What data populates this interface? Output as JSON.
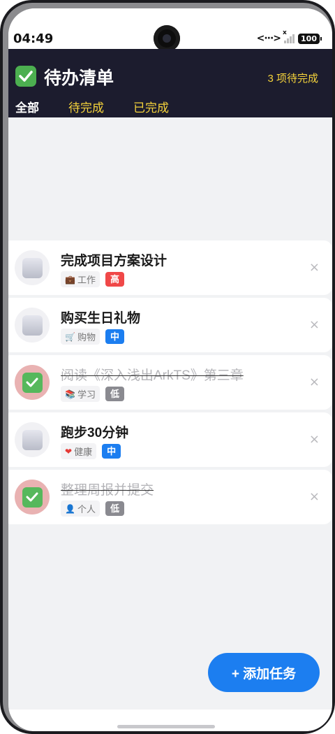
{
  "status_bar": {
    "time": "04:49",
    "network_symbol": "<···>",
    "signal_x": "x",
    "battery": "100"
  },
  "header": {
    "title": "待办清单",
    "pending_text": "3 项待完成",
    "tabs": [
      {
        "label": "全部",
        "active": true
      },
      {
        "label": "待完成",
        "active": false
      },
      {
        "label": "已完成",
        "active": false
      }
    ]
  },
  "tasks": [
    {
      "title": "完成项目方案设计",
      "category_icon": "briefcase-icon",
      "category_emoji": "💼",
      "category": "工作",
      "priority": "高",
      "priority_color": "#f04848",
      "done": false
    },
    {
      "title": "购买生日礼物",
      "category_icon": "cart-icon",
      "category_emoji": "🛒",
      "category": "购物",
      "priority": "中",
      "priority_color": "#1c7ef0",
      "done": false
    },
    {
      "title": "阅读《深入浅出ArkTS》第三章",
      "category_icon": "books-icon",
      "category_emoji": "📚",
      "category": "学习",
      "priority": "低",
      "priority_color": "#8a8a90",
      "done": true
    },
    {
      "title": "跑步30分钟",
      "category_icon": "heart-icon",
      "category_emoji": "❤",
      "category": "健康",
      "priority": "中",
      "priority_color": "#1c7ef0",
      "done": false
    },
    {
      "title": "整理周报并提交",
      "category_icon": "person-icon",
      "category_emoji": "👤",
      "category": "个人",
      "priority": "低",
      "priority_color": "#8a8a90",
      "done": true
    }
  ],
  "delete_symbol": "×",
  "fab": {
    "label": "+ 添加任务"
  },
  "colors": {
    "header_bg": "#1c1c2e",
    "accent_yellow": "#f5d33b",
    "primary_blue": "#1c7ef0",
    "done_green": "#56b85c"
  }
}
